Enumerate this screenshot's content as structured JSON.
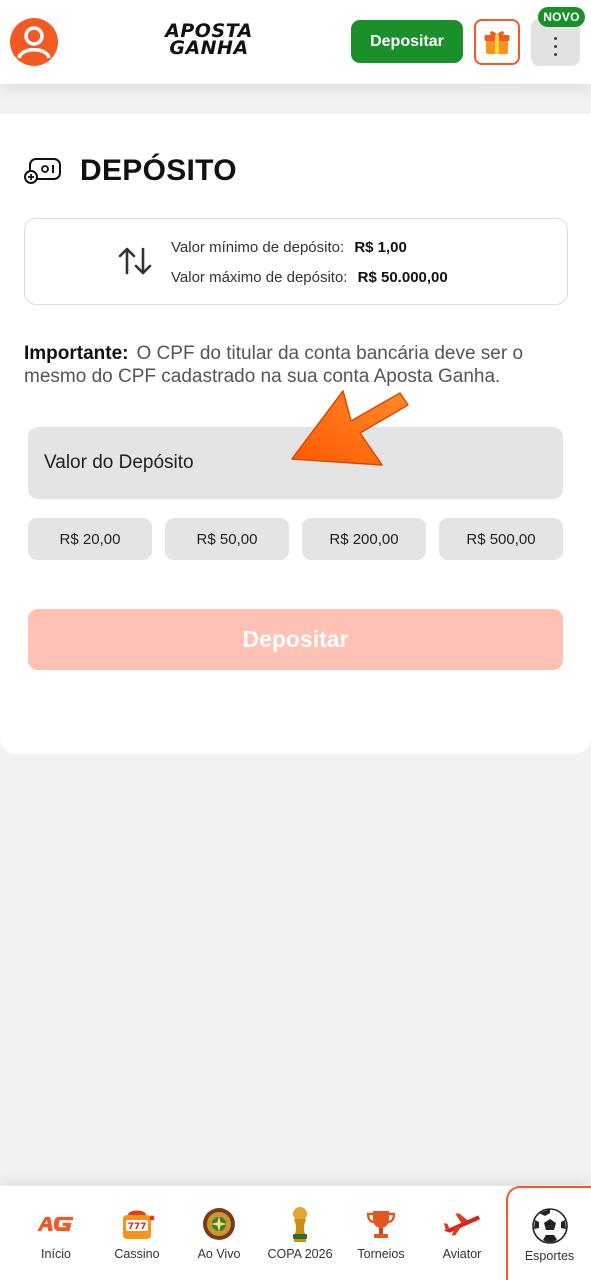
{
  "header": {
    "logo_line1": "APOSTA",
    "logo_line2": "GANHA",
    "deposit_button": "Depositar",
    "novo_badge": "NOVO",
    "brand_color": "#f15a24",
    "accent_green": "#1a8f2a"
  },
  "deposit": {
    "title": "DEPÓSITO",
    "min_label": "Valor mínimo de depósito:",
    "min_value": "R$ 1,00",
    "max_label": "Valor máximo de depósito:",
    "max_value": "R$ 50.000,00",
    "important_label": "Importante:",
    "important_text": "O CPF do titular da conta bancária deve ser o mesmo do CPF cadastrado na sua conta Aposta Ganha.",
    "amount_placeholder": "Valor do Depósito",
    "quick_amounts": [
      "R$ 20,00",
      "R$ 50,00",
      "R$ 200,00",
      "R$ 500,00"
    ],
    "submit_label": "Depositar"
  },
  "nav": {
    "items": [
      {
        "label": "Início",
        "icon": "ag-logo-icon"
      },
      {
        "label": "Cassino",
        "icon": "slot-machine-icon"
      },
      {
        "label": "Ao Vivo",
        "icon": "roulette-icon"
      },
      {
        "label": "COPA 2026",
        "icon": "world-cup-trophy-icon"
      },
      {
        "label": "Torneios",
        "icon": "trophy-cup-icon"
      },
      {
        "label": "Aviator",
        "icon": "airplane-icon"
      },
      {
        "label": "Esportes",
        "icon": "soccer-ball-icon"
      }
    ],
    "active": "Esportes"
  }
}
